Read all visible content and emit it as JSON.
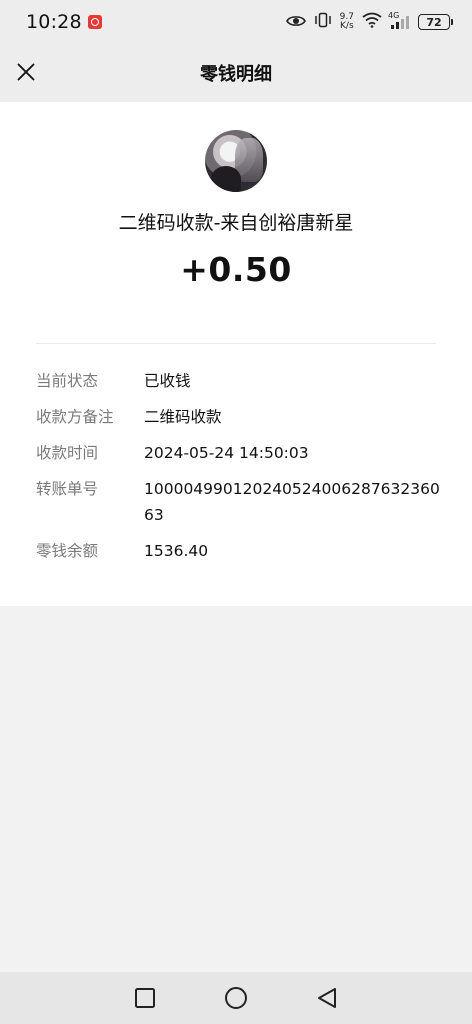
{
  "status_bar": {
    "time": "10:28",
    "speed_value": "9.7",
    "speed_unit": "K/s",
    "network": "4G",
    "battery": "72"
  },
  "nav": {
    "title": "零钱明细"
  },
  "transaction": {
    "payer": "二维码收款-来自创裕唐新星",
    "amount": "+0.50"
  },
  "details": [
    {
      "label": "当前状态",
      "value": "已收钱"
    },
    {
      "label": "收款方备注",
      "value": "二维码收款"
    },
    {
      "label": "收款时间",
      "value": "2024-05-24 14:50:03"
    },
    {
      "label": "转账单号",
      "value": "100004990120240524006287632360 63"
    },
    {
      "label": "零钱余额",
      "value": "1536.40"
    }
  ]
}
